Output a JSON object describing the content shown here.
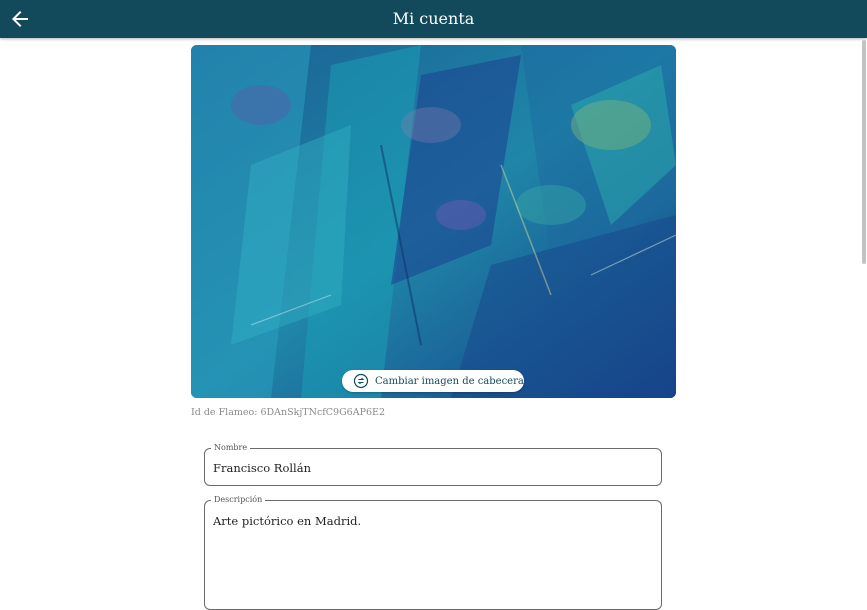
{
  "appbar": {
    "title": "Mi cuenta",
    "background": "#124a5c",
    "back_icon": "arrow-left-icon"
  },
  "header_image": {
    "change_button_label": "Cambiar imagen de cabecera",
    "change_icon": "swap-icon"
  },
  "flameo_id": "Id de Flameo: 6DAnSkjTNcfC9G6AP6E2",
  "form": {
    "name": {
      "label": "Nombre",
      "value": "Francisco Rollán"
    },
    "description": {
      "label": "Descripción",
      "value": "Arte pictórico en Madrid."
    }
  }
}
